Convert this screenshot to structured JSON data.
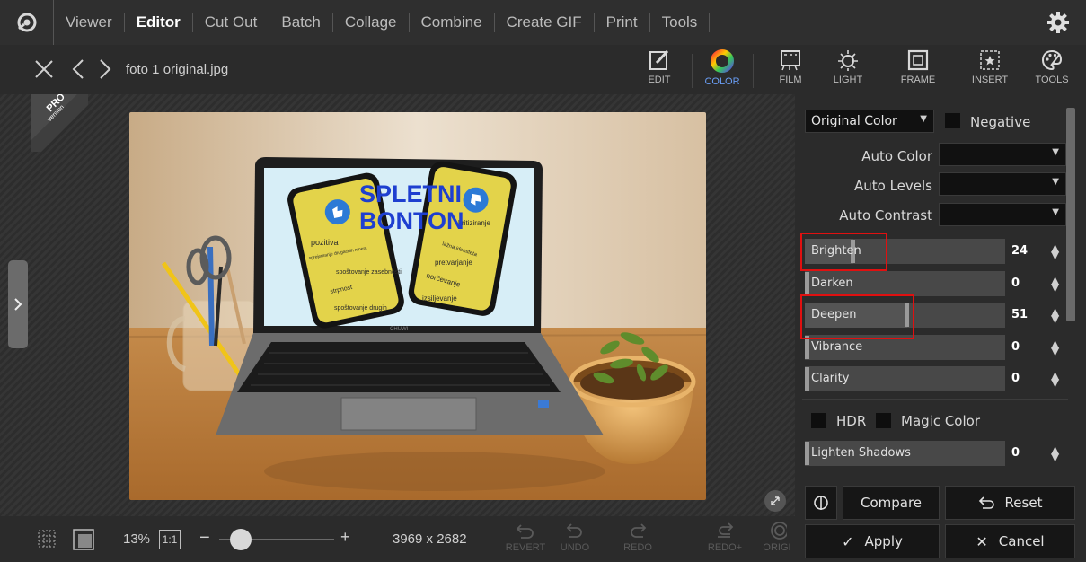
{
  "nav": {
    "items": [
      "Viewer",
      "Editor",
      "Cut Out",
      "Batch",
      "Collage",
      "Combine",
      "Create GIF",
      "Print",
      "Tools"
    ],
    "active_index": 1
  },
  "file": {
    "name": "foto 1 original.jpg"
  },
  "toolbar": {
    "tools": [
      "EDIT",
      "COLOR",
      "FILM",
      "LIGHT",
      "FRAME",
      "INSERT",
      "TOOLS"
    ],
    "active": "COLOR"
  },
  "badge": {
    "pro": "PRO",
    "version": "Version"
  },
  "photo": {
    "screen_title_1": "SPLETNI",
    "screen_title_2": "BONTON",
    "left_phone": [
      "pozitiva",
      "sprejemanje drugačnih mnenj",
      "spoštovanje zasebnosti",
      "strpnost",
      "spoštovanje drugih"
    ],
    "right_phone": [
      "kritiziranje",
      "lažna identiteta",
      "pretvarjanje",
      "norčevanje",
      "izsiljevanje"
    ],
    "laptop_brand": "CHUWI"
  },
  "bottom": {
    "zoom": "13%",
    "one_to_one": "1:1",
    "minus": "−",
    "plus": "+",
    "dimensions": "3969 x 2682",
    "zoom_fraction": 0.19,
    "history": [
      "REVERT",
      "UNDO",
      "REDO",
      "REDO+",
      "ORIGI"
    ]
  },
  "panel": {
    "color_mode": "Original Color",
    "negative_label": "Negative",
    "auto_color": "Auto Color",
    "auto_levels": "Auto Levels",
    "auto_contrast": "Auto Contrast",
    "sliders": [
      {
        "label": "Brighten",
        "value": "24",
        "fraction": 0.24
      },
      {
        "label": "Darken",
        "value": "0",
        "fraction": 0.0
      },
      {
        "label": "Deepen",
        "value": "51",
        "fraction": 0.51
      },
      {
        "label": "Vibrance",
        "value": "0",
        "fraction": 0.0
      },
      {
        "label": "Clarity",
        "value": "0",
        "fraction": 0.0
      }
    ],
    "hdr_label": "HDR",
    "magic_color_label": "Magic Color",
    "lighten_shadows": {
      "label": "Lighten Shadows",
      "value": "0",
      "fraction": 0.0
    },
    "compare_label": "Compare",
    "reset_label": "Reset",
    "apply_label": "Apply",
    "cancel_label": "Cancel"
  },
  "colors": {
    "accent": "#6a9ef5",
    "highlight_box": "#e01010",
    "panel_bg": "#2b2b2b",
    "nav_bg": "#2f2f2f"
  }
}
